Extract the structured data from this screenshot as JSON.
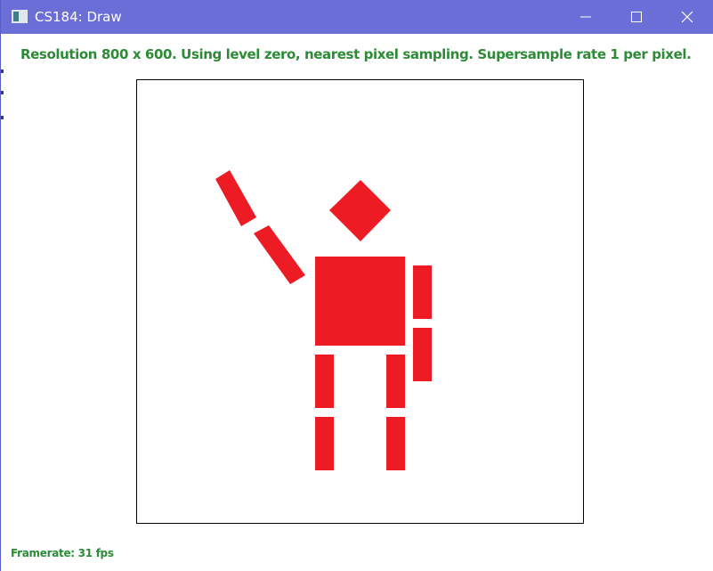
{
  "window": {
    "title": "CS184: Draw",
    "controls": [
      "minimize",
      "maximize",
      "close"
    ]
  },
  "status": {
    "info_line": "Resolution 800 x 600. Using level zero, nearest pixel sampling. Supersample rate 1 per pixel.",
    "framerate": "Framerate: 31 fps"
  },
  "colors": {
    "titlebar": "#6b6ed6",
    "status_text": "#2d8a36",
    "shape_fill": "#ed1b24"
  },
  "icons": {
    "app": "app-window-icon",
    "minimize": "minimize-icon",
    "maximize": "maximize-icon",
    "close": "close-icon"
  }
}
